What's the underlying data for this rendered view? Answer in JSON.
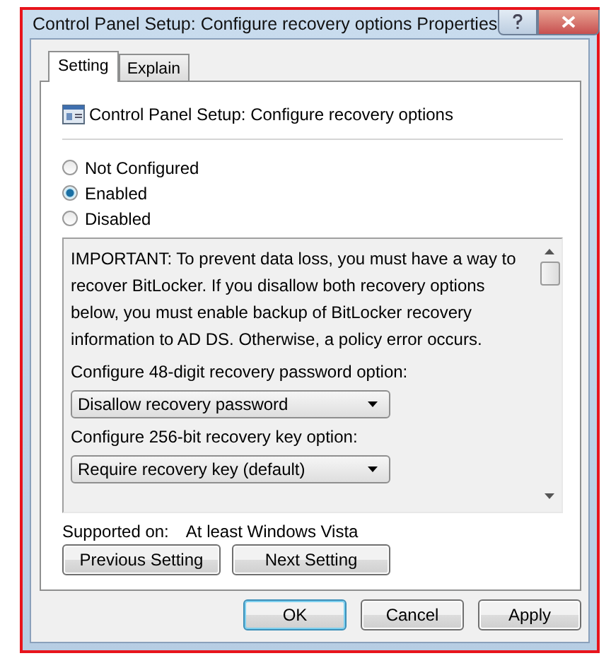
{
  "window": {
    "title": "Control Panel Setup: Configure recovery options Properties"
  },
  "tabs": [
    {
      "label": "Setting",
      "selected": true
    },
    {
      "label": "Explain",
      "selected": false
    }
  ],
  "policy_title": "Control Panel Setup: Configure recovery options",
  "states": [
    {
      "label": "Not Configured",
      "selected": false
    },
    {
      "label": "Enabled",
      "selected": true
    },
    {
      "label": "Disabled",
      "selected": false
    }
  ],
  "options": {
    "description": "IMPORTANT: To prevent data loss, you must have a way to recover BitLocker. If you disallow both recovery options below, you must enable backup of BitLocker recovery information to AD DS. Otherwise, a policy error occurs.",
    "fields": [
      {
        "label": "Configure 48-digit recovery password option:",
        "value": "Disallow recovery password"
      },
      {
        "label": "Configure 256-bit recovery key option:",
        "value": "Require recovery key (default)"
      }
    ]
  },
  "supported": {
    "label": "Supported on:",
    "value": "At least Windows Vista"
  },
  "nav_buttons": [
    "Previous Setting",
    "Next Setting"
  ],
  "dialog_buttons": [
    {
      "label": "OK",
      "default": true
    },
    {
      "label": "Cancel",
      "default": false
    },
    {
      "label": "Apply",
      "default": false
    }
  ]
}
